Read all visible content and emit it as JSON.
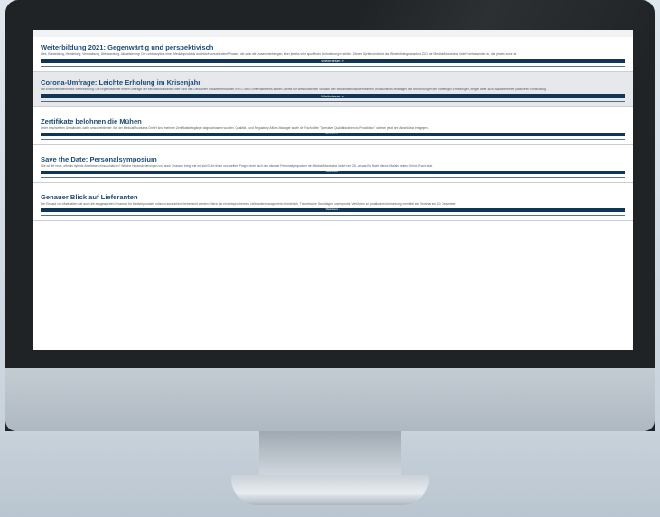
{
  "articles": [
    {
      "title": "Weiterbildung 2021: Gegenwärtig und perspektivisch",
      "text": "Idee, Entwicklung, Herstellung, Vermarktung, Überwachung, Aktualisierung: Der Lebenszyklus eines Medizinprodukts durchläuft verschiedene Phasen, die zwar alle zusammenhängen, aber jeweils sehr spezifische Anforderungen stellen. Dieses Spektrum deckt das Weiterbildungsangebot 2021 der MedicalMountains GmbH umfassender ab, als jemals zuvor ab.",
      "button": "Weiterlesen »"
    },
    {
      "title": "Corona-Umfrage: Leichte Erholung im Krisenjahr",
      "text": "Die Anzeichen stehen auf Verbesserung: Die Ergebnisse der dritten Umfrage der MedicalMountains GmbH und des Deutschen Industrieverbandes SPECTARIS innerhalb eines halben Jahres zur wirtschaftlichen Situation der Medizintechnikunternehmen Deutschlands bestätigen die Befürchtungen der vorherigen Erhebungen, zeigen aber auch Ansätzen einer positiveren Entwicklung.",
      "button": "Weiterlesen »"
    },
    {
      "title": "Zertifikate belohnen die Mühen",
      "text": "Unter erschwerten Umständen, dafür umso verdienter: Bei der MedicalMountains GmbH sind mehrere Zertifikatslehrgänge abgeschlossen worden. Qualitäts- und Regulatory Affairs Manager sowie die Fachkräfte \"Operative Qualitätssicherung Produktion\" nahmen jetzt ihre Abschlüsse entgegen.",
      "button": "Weiterlesen »"
    },
    {
      "title": "Save the Date: Personalsymposium",
      "text": "Wie ist die neue, oftmals hybride Arbeitswelt einzuschätzen? Welche Herausforderungen und auch Chancen bringt sie mit sich? Um diese und weitere Fragen dreht sich das nächste Personalsymposium der MedicalMountains GmbH am 26. Januar. Es findet dieses Mal als reines Online-Event statt.",
      "button": "Weiterlesen »"
    },
    {
      "title": "Genauer Blick auf Lieferanten",
      "text": "Der Einkauf von Materialien wie auch die ausgelagerten Prozesse für Medizinprodukte müssen ausreichend beherrscht werden. Hierzu ist ein entsprechendes Lieferantenmanagement erforderlich. Theoretische Grundlagen und erprobte Verfahren zur praktischen Umsetzung vermittelt ein Seminar am 10. Dezember.",
      "button": "Weiterlesen »"
    }
  ]
}
